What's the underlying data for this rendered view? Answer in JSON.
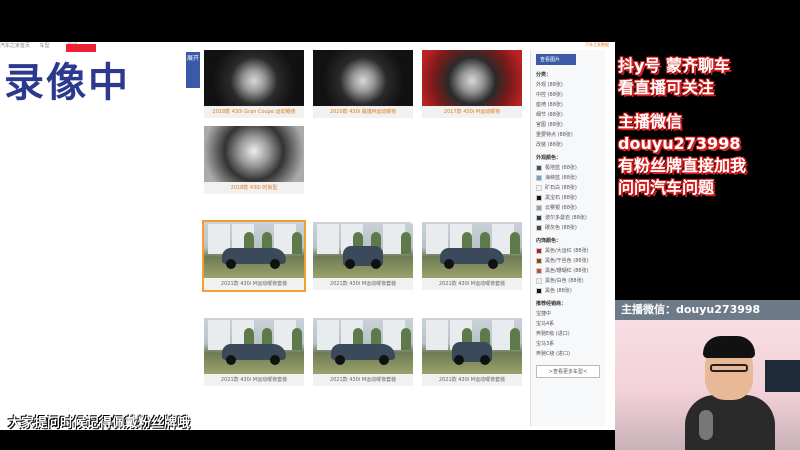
{
  "recording_label": "录像中",
  "top_strip": [
    "汽车之家首页",
    "车型",
    "",
    "视频"
  ],
  "side_tab_label": "展开",
  "top_badge": "汽车之家数据",
  "tiles": [
    {
      "caption": "2018款 430i Gran Coupe 运动曜夜",
      "style": "orange",
      "kind": "interior"
    },
    {
      "caption": "2020款 430i 敞篷M运动曜夜",
      "style": "orange",
      "kind": "interior"
    },
    {
      "caption": "2017款 430i M运动曜夜",
      "style": "orange",
      "kind": "interior red"
    },
    {
      "caption": "2018款 430i 时尚型",
      "style": "orange",
      "kind": "interior light"
    },
    {
      "caption": "2021款 430i M运动曜夜套装",
      "style": "",
      "kind": "exterior side"
    },
    {
      "caption": "2021款 430i M运动曜夜套装",
      "style": "",
      "kind": "exterior front"
    },
    {
      "caption": "2021款 430i M运动曜夜套装",
      "style": "",
      "kind": "exterior side"
    },
    {
      "caption": "2021款 430i M运动曜夜套装",
      "style": "",
      "kind": "exterior side"
    },
    {
      "caption": "2021款 430i M运动曜夜套装",
      "style": "",
      "kind": "exterior side"
    },
    {
      "caption": "2021款 430i M运动曜夜套装",
      "style": "",
      "kind": "exterior front"
    }
  ],
  "filter": {
    "button": "查看图片",
    "section_category": "分类：",
    "categories": [
      "外观 (88张)",
      "中控 (88张)",
      "座椅 (88张)",
      "细节 (88张)",
      "官图 (88张)",
      "重要特点 (88张)",
      "改装 (88张)"
    ],
    "section_exterior": "外观颜色：",
    "exterior_colors": [
      {
        "label": "极地蓝 (88张)",
        "color": "#3e4f66"
      },
      {
        "label": "海峡蓝 (88张)",
        "color": "#6aa3c8"
      },
      {
        "label": "矿石白 (88张)",
        "color": "#f2f2f2"
      },
      {
        "label": "黑宝石 (88张)",
        "color": "#111111"
      },
      {
        "label": "云雾银 (88张)",
        "color": "#9aa0a4"
      },
      {
        "label": "波尔多曼岩 (88张)",
        "color": "#2a3a55"
      },
      {
        "label": "碳灰色 (88张)",
        "color": "#4a4a4a"
      }
    ],
    "section_interior": "内饰颜色：",
    "interior_colors": [
      {
        "label": "黑色/大运红 (88张)",
        "color": "#b22222"
      },
      {
        "label": "黑色/干邑色 (88张)",
        "color": "#8b4a1a"
      },
      {
        "label": "黑色/珊瑚红 (88张)",
        "color": "#c8502a"
      },
      {
        "label": "黑色/白色 (88张)",
        "color": "#eeeeee"
      },
      {
        "label": "黑色 (88张)",
        "color": "#111111"
      }
    ],
    "section_dealers": "推荐经销商：",
    "dealers": [
      "宝捷中",
      "宝马4系",
      "奔驰E级 (进口)",
      "宝马3系",
      "奔驰C级 (进口)"
    ],
    "more_button": ">查看更多车型<"
  },
  "overlay": {
    "lines1": [
      "抖y号  蒙齐聊车",
      "看直播可关注"
    ],
    "lines2": [
      "主播微信",
      "douyu273998",
      "有粉丝牌直接加我",
      "问问汽车问题"
    ]
  },
  "cam_strip": "主播微信：douyu273998",
  "caption": "大家提问时候记得佩戴粉丝牌哦"
}
